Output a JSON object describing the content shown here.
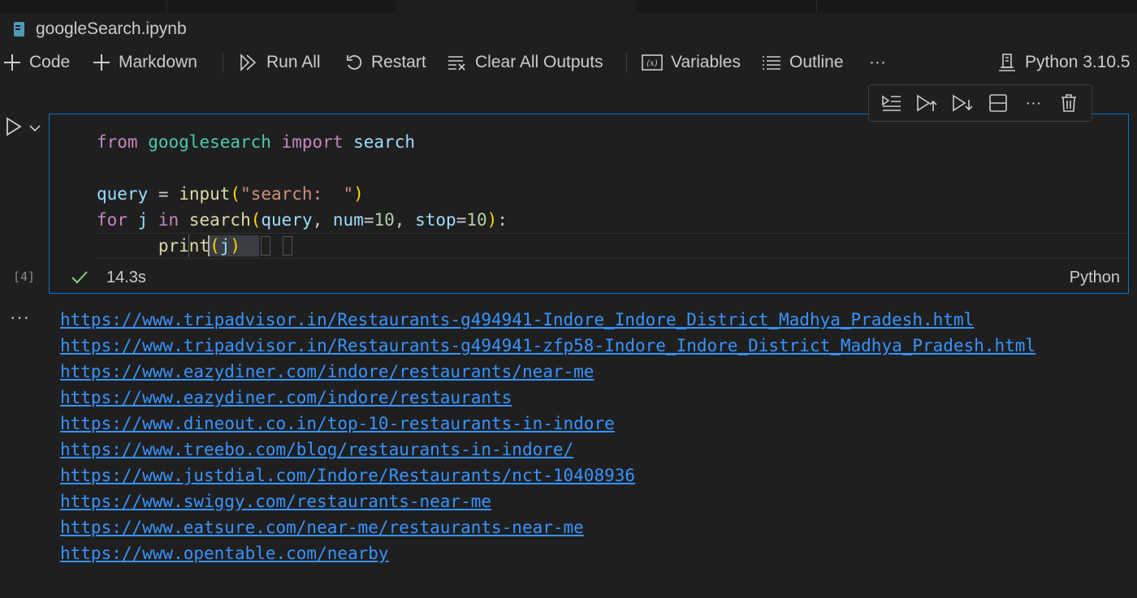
{
  "notebook": {
    "file_name": "googleSearch.ipynb",
    "icon": "notebook-icon"
  },
  "toolbar": {
    "code_label": "Code",
    "markdown_label": "Markdown",
    "run_all_label": "Run All",
    "restart_label": "Restart",
    "clear_outputs_label": "Clear All Outputs",
    "variables_label": "Variables",
    "outline_label": "Outline",
    "more_label": "···",
    "kernel_label": "Python 3.10.5"
  },
  "cell_toolbar": {
    "icons": [
      "run-next-icon",
      "execute-above-icon",
      "execute-below-icon",
      "split-cell-icon",
      "more-icon",
      "delete-icon"
    ],
    "more_label": "···"
  },
  "cell": {
    "execution_count": "[4]",
    "duration": "14.3s",
    "language": "Python",
    "status": "success",
    "code_lines": [
      "from googlesearch import search",
      "",
      "query = input(\"search:  \")",
      "for j in search(query, num=10, stop=10):",
      "      print(j)"
    ]
  },
  "output": {
    "more_label": "···",
    "links": [
      "https://www.tripadvisor.in/Restaurants-g494941-Indore_Indore_District_Madhya_Pradesh.html",
      "https://www.tripadvisor.in/Restaurants-g494941-zfp58-Indore_Indore_District_Madhya_Pradesh.html",
      "https://www.eazydiner.com/indore/restaurants/near-me",
      "https://www.eazydiner.com/indore/restaurants",
      "https://www.dineout.co.in/top-10-restaurants-in-indore",
      "https://www.treebo.com/blog/restaurants-in-indore/",
      "https://www.justdial.com/Indore/Restaurants/nct-10408936",
      "https://www.swiggy.com/restaurants-near-me",
      "https://www.eatsure.com/near-me/restaurants-near-me",
      "https://www.opentable.com/nearby"
    ]
  },
  "colors": {
    "background": "#1f1f1f",
    "accent": "#0078d4",
    "link": "#3794ff",
    "success": "#89d185"
  }
}
